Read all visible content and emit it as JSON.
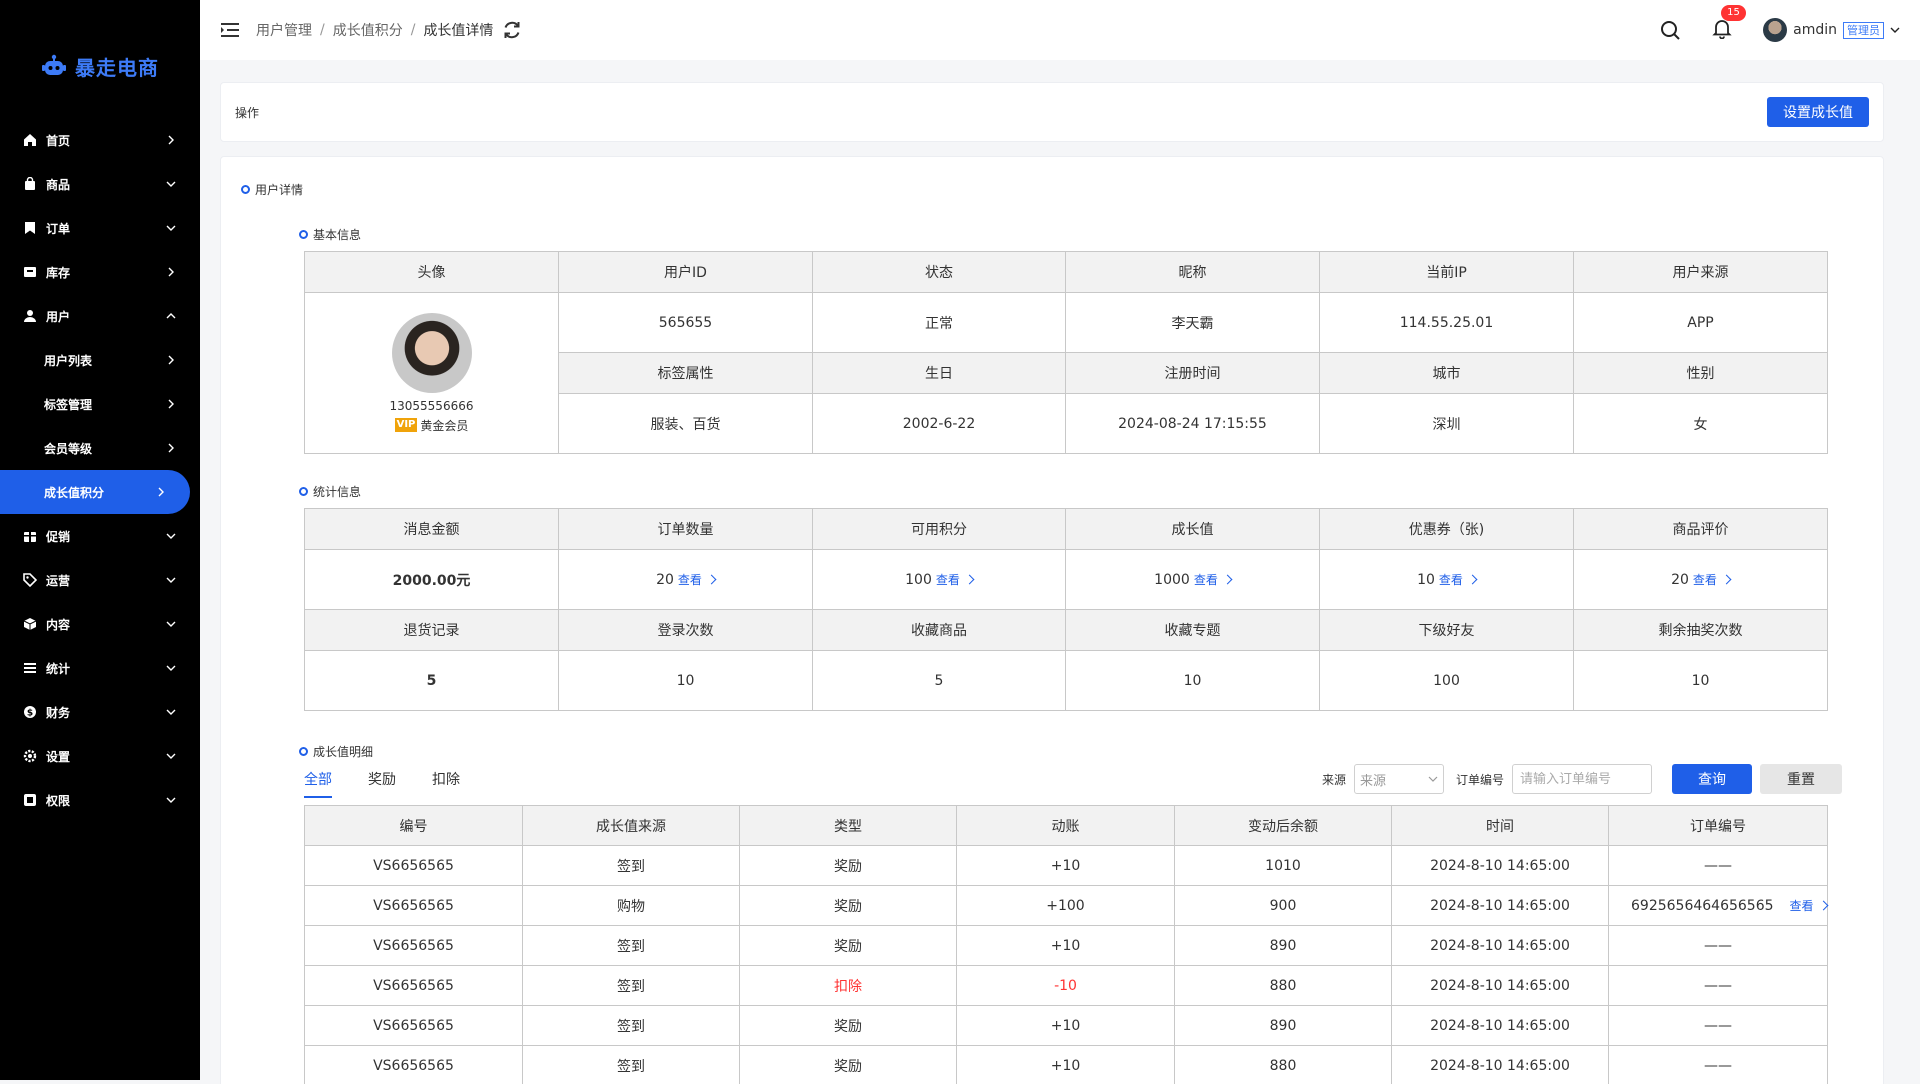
{
  "app": {
    "name": "暴走电商"
  },
  "sidebar": {
    "items": [
      {
        "label": "首页",
        "icon": "home-icon",
        "arrow": "right"
      },
      {
        "label": "商品",
        "icon": "bag-icon",
        "arrow": "down"
      },
      {
        "label": "订单",
        "icon": "bookmark-icon",
        "arrow": "down"
      },
      {
        "label": "库存",
        "icon": "box-icon",
        "arrow": "right"
      },
      {
        "label": "用户",
        "icon": "user-icon",
        "arrow": "up"
      },
      {
        "label": "用户列表",
        "arrow": "right"
      },
      {
        "label": "标签管理",
        "arrow": "right"
      },
      {
        "label": "会员等级",
        "arrow": "right"
      },
      {
        "label": "成长值积分",
        "arrow": "right"
      },
      {
        "label": "促销",
        "icon": "gift-icon",
        "arrow": "down"
      },
      {
        "label": "运营",
        "icon": "tag-icon",
        "arrow": "down"
      },
      {
        "label": "内容",
        "icon": "cube-icon",
        "arrow": "down"
      },
      {
        "label": "统计",
        "icon": "chart-icon",
        "arrow": "down"
      },
      {
        "label": "财务",
        "icon": "dollar-icon",
        "arrow": "down"
      },
      {
        "label": "设置",
        "icon": "gear-icon",
        "arrow": "down"
      },
      {
        "label": "权限",
        "icon": "shield-icon",
        "arrow": "down"
      }
    ]
  },
  "header": {
    "breadcrumb": [
      "用户管理",
      "成长值积分",
      "成长值详情"
    ],
    "notifications": "15",
    "username": "amdin",
    "role": "管理员"
  },
  "op": {
    "title": "操作",
    "button": "设置成长值"
  },
  "detail": {
    "title": "用户详情",
    "basic_title": "基本信息",
    "basic_headers_1": [
      "头像",
      "用户ID",
      "状态",
      "昵称",
      "当前IP",
      "用户来源"
    ],
    "basic_values_1": [
      "565655",
      "正常",
      "李天霸",
      "114.55.25.01",
      "APP"
    ],
    "basic_headers_2": [
      "标签属性",
      "生日",
      "注册时间",
      "城市",
      "性别"
    ],
    "basic_values_2": [
      "服装、百货",
      "2002-6-22",
      "2024-08-24 17:15:55",
      "深圳",
      "女"
    ],
    "phone": "13055556666",
    "vip_tag": "VIP",
    "vip_label": "黄金会员",
    "stats_title": "统计信息",
    "stats_headers_1": [
      "消息金额",
      "订单数量",
      "可用积分",
      "成长值",
      "优惠券（张)",
      "商品评价"
    ],
    "stats_values_1": [
      "2000.00元",
      "20",
      "100",
      "1000",
      "10",
      "20"
    ],
    "link_label": "查看",
    "stats_headers_2": [
      "退货记录",
      "登录次数",
      "收藏商品",
      "收藏专题",
      "下级好友",
      "剩余抽奖次数"
    ],
    "stats_values_2": [
      "5",
      "10",
      "5",
      "10",
      "100",
      "10"
    ],
    "growth_title": "成长值明细"
  },
  "tabs": [
    "全部",
    "奖励",
    "扣除"
  ],
  "filters": {
    "source_label": "来源",
    "source_placeholder": "来源",
    "order_label": "订单编号",
    "order_placeholder": "请输入订单编号",
    "query": "查询",
    "reset": "重置"
  },
  "growth_table": {
    "headers": [
      "编号",
      "成长值来源",
      "类型",
      "动账",
      "变动后余额",
      "时间",
      "订单编号"
    ],
    "rows": [
      [
        "VS6656565",
        "签到",
        "奖励",
        "+10",
        "1010",
        "2024-8-10 14:65:00",
        "——"
      ],
      [
        "VS6656565",
        "购物",
        "奖励",
        "+100",
        "900",
        "2024-8-10 14:65:00",
        "6925656464656565"
      ],
      [
        "VS6656565",
        "签到",
        "奖励",
        "+10",
        "890",
        "2024-8-10 14:65:00",
        "——"
      ],
      [
        "VS6656565",
        "签到",
        "扣除",
        "-10",
        "880",
        "2024-8-10 14:65:00",
        "——"
      ],
      [
        "VS6656565",
        "签到",
        "奖励",
        "+10",
        "890",
        "2024-8-10 14:65:00",
        "——"
      ],
      [
        "VS6656565",
        "签到",
        "奖励",
        "+10",
        "880",
        "2024-8-10 14:65:00",
        "——"
      ]
    ]
  },
  "colors": {
    "primary": "#1f5fe8",
    "sidebar": "#000000",
    "danger": "#ff3333"
  }
}
